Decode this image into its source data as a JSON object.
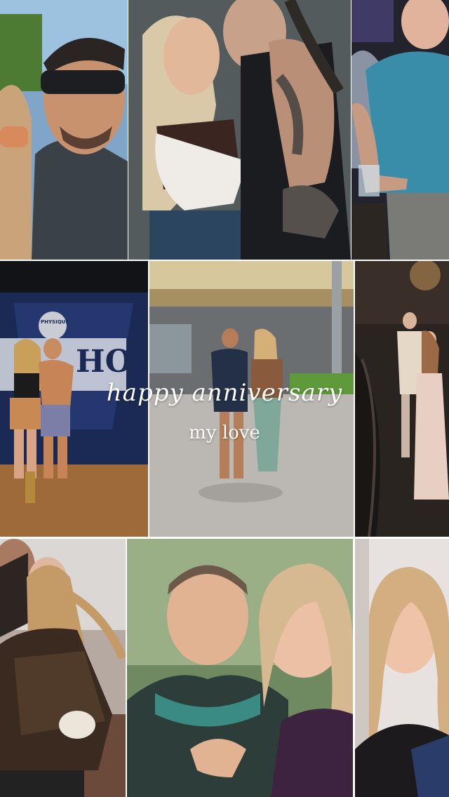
{
  "overlay": {
    "title": "happy anniversary",
    "subtitle": "my love"
  },
  "colors": {
    "background": "#ffffff",
    "text": "#ffffff"
  },
  "banner_text": "PHYSIQUE",
  "banner_partial": "HO"
}
